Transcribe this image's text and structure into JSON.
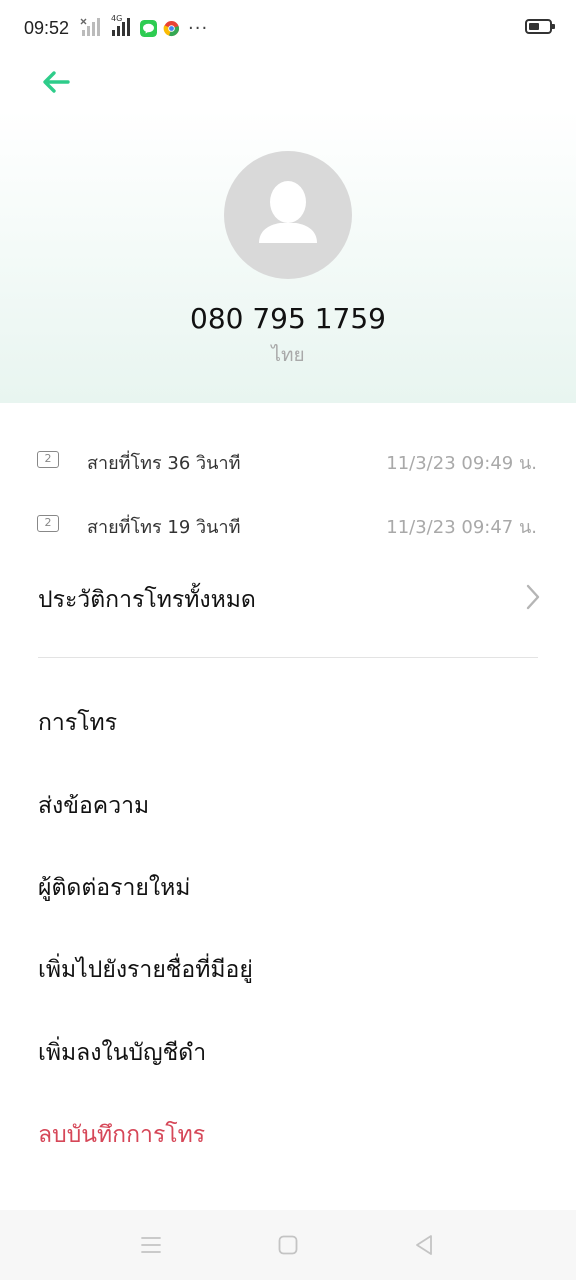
{
  "status_bar": {
    "time": "09:52",
    "network_label": "4G",
    "battery_level": 0.55,
    "icons": [
      "signal-off-icon",
      "signal-4g-icon",
      "line-app-icon",
      "chrome-icon",
      "more-dots-icon",
      "battery-icon"
    ]
  },
  "header": {
    "back_icon": "back-arrow-icon",
    "accent_color": "#2ecc8a",
    "phone_number": "080 795 1759",
    "country": "ไทย"
  },
  "call_log": [
    {
      "sim": "2",
      "type": "สายที่โทร  36 วินาที",
      "time": "11/3/23 09:49 น."
    },
    {
      "sim": "2",
      "type": "สายที่โทร  19 วินาที",
      "time": "11/3/23 09:47 น."
    }
  ],
  "history_link": {
    "label": "ประวัติการโทรทั้งหมด"
  },
  "actions": {
    "call": "การโทร",
    "message": "ส่งข้อความ",
    "new_contact": "ผู้ติดต่อรายใหม่",
    "add_existing": "เพิ่มไปยังรายชื่อที่มีอยู่",
    "blacklist": "เพิ่มลงในบัญชีดำ",
    "delete_log": "ลบบันทึกการโทร"
  },
  "danger_color": "#d64758",
  "nav_bar": {
    "icons": [
      "menu-icon",
      "home-icon",
      "back-icon"
    ]
  }
}
